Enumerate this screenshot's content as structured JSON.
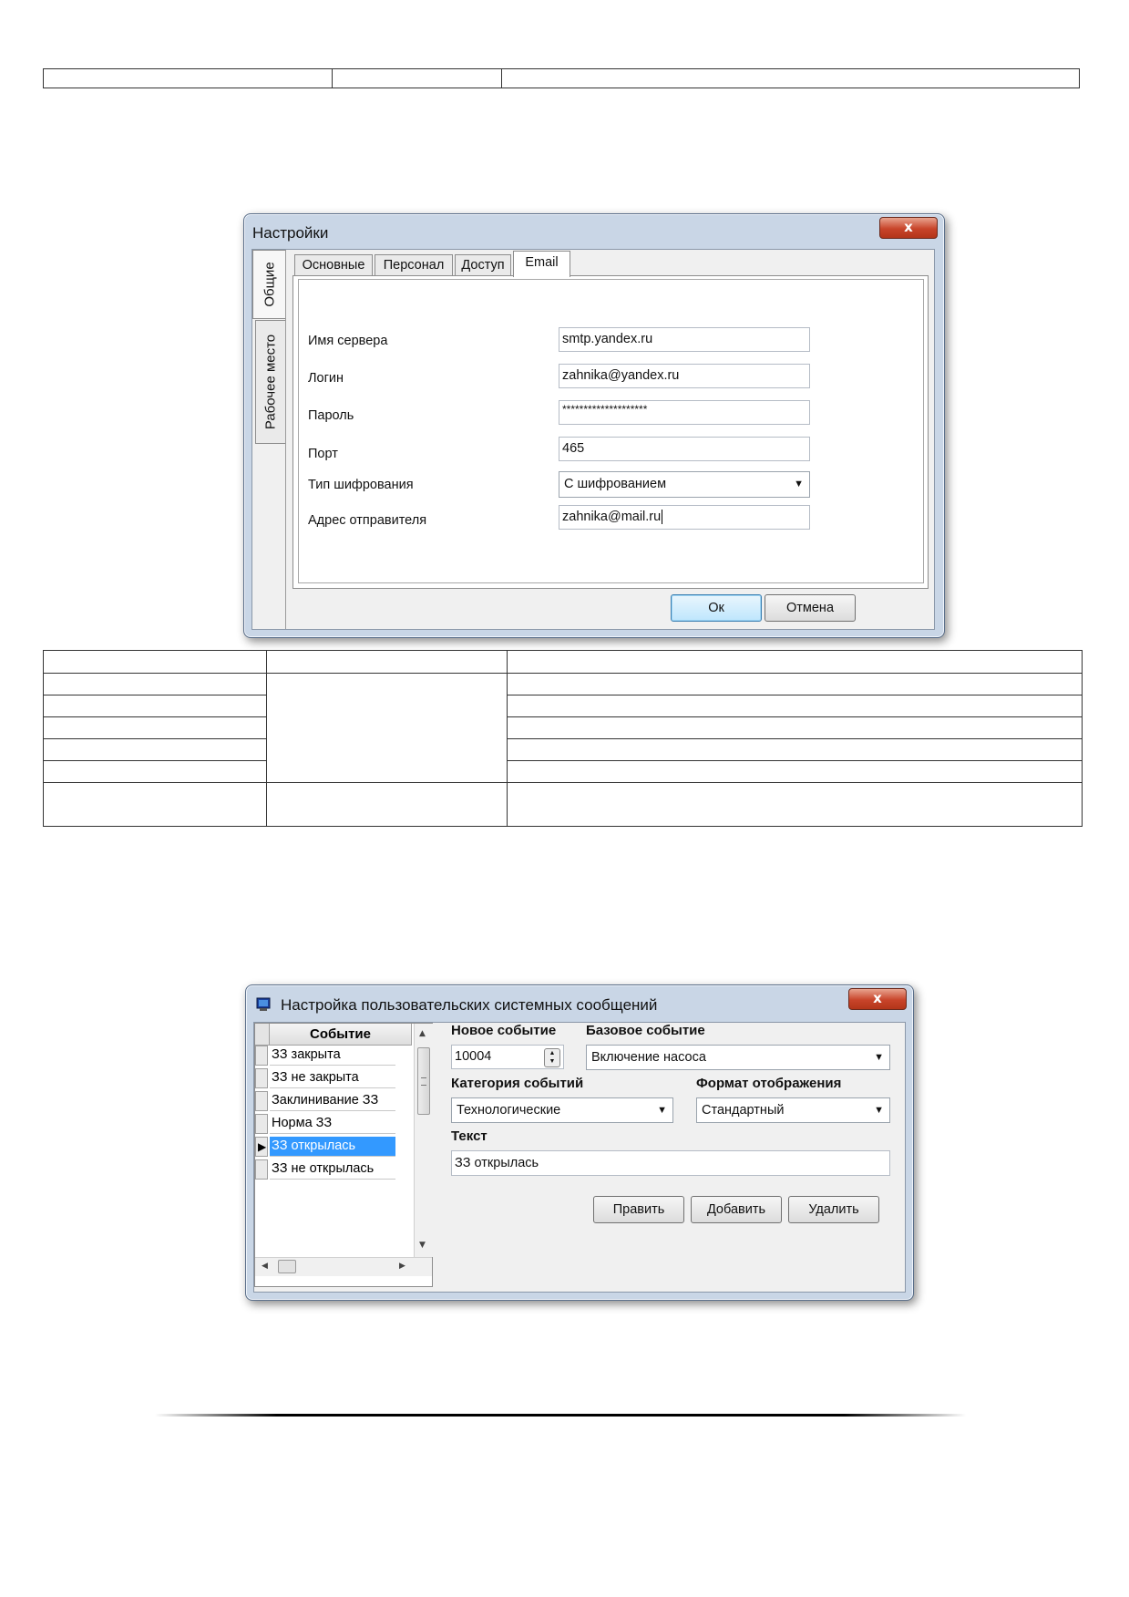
{
  "settings_dialog": {
    "title": "Настройки",
    "close_label": "x",
    "side_tabs": [
      "Общие",
      "Рабочее место"
    ],
    "tabs": [
      "Основные",
      "Персонал",
      "Доступ",
      "Email"
    ],
    "active_tab": "Email",
    "fields": [
      {
        "label": "Имя сервера",
        "value": "smtp.yandex.ru"
      },
      {
        "label": "Логин",
        "value": "zahnika@yandex.ru"
      },
      {
        "label": "Пароль",
        "value": "********************"
      },
      {
        "label": "Порт",
        "value": "465"
      },
      {
        "label": "Тип шифрования",
        "value": "С шифрованием"
      },
      {
        "label": "Адрес отправителя",
        "value": "zahnika@mail.ru"
      }
    ],
    "ok_label": "Ок",
    "cancel_label": "Отмена"
  },
  "messages_dialog": {
    "title": "Настройка пользовательских системных сообщений",
    "close_label": "x",
    "grid_header": "Событие",
    "events": [
      "ЗЗ закрыта",
      "ЗЗ не закрыта",
      "Заклинивание ЗЗ",
      "Норма ЗЗ",
      "ЗЗ открылась",
      "ЗЗ не открылась"
    ],
    "selected_event_index": 4,
    "new_event_label": "Новое событие",
    "new_event_value": "10004",
    "base_event_label": "Базовое событие",
    "base_event_value": "Включение насоса",
    "category_label": "Категория событий",
    "category_value": "Технологические",
    "format_label": "Формат отображения",
    "format_value": "Стандартный",
    "text_label": "Текст",
    "text_value": "ЗЗ открылась",
    "edit_label": "Править",
    "add_label": "Добавить",
    "delete_label": "Удалить"
  }
}
